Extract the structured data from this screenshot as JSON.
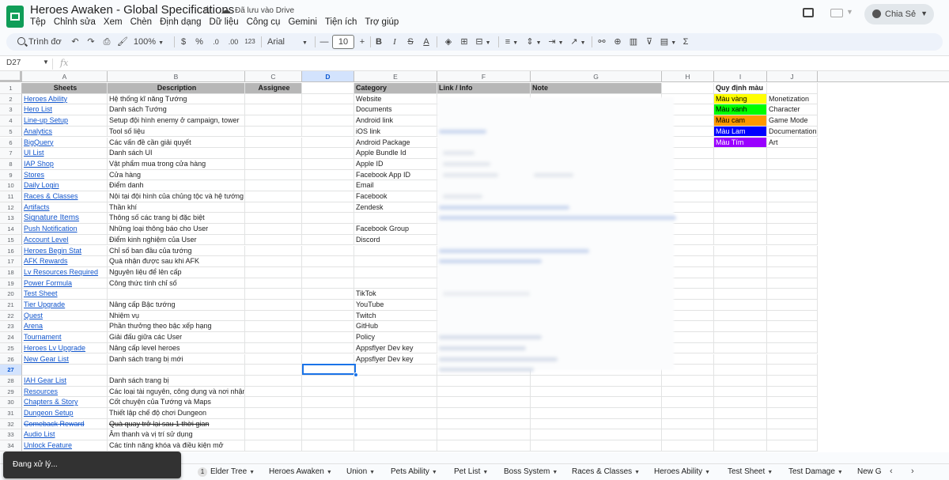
{
  "app": {
    "title": "Heroes Awaken - Global Specifications",
    "saved_status": "Đã lưu vào Drive",
    "share_label": "Chia Sẻ"
  },
  "menu": [
    "Tệp",
    "Chỉnh sửa",
    "Xem",
    "Chèn",
    "Định dạng",
    "Dữ liệu",
    "Công cụ",
    "Gemini",
    "Tiện ích",
    "Trợ giúp"
  ],
  "toolbar": {
    "search_label": "Trình đơ",
    "zoom": "100%",
    "currency": "$",
    "percent": "%",
    "dec_decrease": ".0",
    "dec_increase": ".00",
    "num_format": "123",
    "font": "Arial",
    "font_size": "10",
    "bold": "B",
    "italic": "I",
    "strike": "S",
    "text_color": "A",
    "sigma": "Σ",
    "minus": "—",
    "plus": "+"
  },
  "formula_bar": {
    "name_box": "D27",
    "fx": "fx"
  },
  "columns": [
    "A",
    "B",
    "C",
    "D",
    "E",
    "F",
    "G",
    "H",
    "I",
    "J"
  ],
  "selected_column": "D",
  "selected_row": 27,
  "header_row": {
    "sheets": "Sheets",
    "description": "Description",
    "assignee": "Assignee",
    "category": "Category",
    "link_info": "Link / Info",
    "note": "Note",
    "legend_title": "Quy định màu"
  },
  "rows": [
    {
      "n": 1
    },
    {
      "n": 2,
      "a": "Heroes Ability",
      "b": "Hệ thống kĩ năng Tướng",
      "e": "Website"
    },
    {
      "n": 3,
      "a": "Hero List",
      "b": "Danh sách Tướng",
      "e": "Documents"
    },
    {
      "n": 4,
      "a": "Line-up Setup",
      "b": "Setup đội hình enemy ở campaign, tower",
      "e": "Android link"
    },
    {
      "n": 5,
      "a": "Analytics",
      "b": "Tool số liệu",
      "e": "iOS link"
    },
    {
      "n": 6,
      "a": "BigQuery",
      "b": "Các vấn đề cần giải quyết",
      "e": "Android Package"
    },
    {
      "n": 7,
      "a": "UI List",
      "b": "Danh sách UI",
      "e": "Apple Bundle Id"
    },
    {
      "n": 8,
      "a": "IAP Shop",
      "b": "Vật phẩm mua trong cửa hàng",
      "e": "Apple ID"
    },
    {
      "n": 9,
      "a": "Stores",
      "b": "Cửa hàng",
      "e": "Facebook App ID"
    },
    {
      "n": 10,
      "a": "Daily Login",
      "b": "Điểm danh",
      "e": "Email"
    },
    {
      "n": 11,
      "a": "Races & Classes",
      "b": "Nội tại đội hình của chủng tộc và hệ tướng",
      "e": "Facebook"
    },
    {
      "n": 12,
      "a": "Artifacts",
      "b": "Thần khí",
      "e": "Zendesk"
    },
    {
      "n": 13,
      "a": "Signature Items",
      "b": "Thông số các trang bị đặc biệt",
      "e": ""
    },
    {
      "n": 14,
      "a": "Push Notification",
      "b": "Những loại thông báo cho User",
      "e": "Facebook Group"
    },
    {
      "n": 15,
      "a": "Account Level",
      "b": "Điểm kinh nghiệm của User",
      "e": "Discord"
    },
    {
      "n": 16,
      "a": "Heroes Begin Stat",
      "b": "Chỉ số ban đầu của tướng",
      "e": ""
    },
    {
      "n": 17,
      "a": "AFK Rewards",
      "b": "Quà nhận được sau khi AFK",
      "e": ""
    },
    {
      "n": 18,
      "a": "Lv Resources Required",
      "b": "Nguyên liệu để lên cấp",
      "e": ""
    },
    {
      "n": 19,
      "a": "Power Formula",
      "b": "Công thức tính chỉ số",
      "e": ""
    },
    {
      "n": 20,
      "a": "Test Sheet",
      "b": "",
      "e": "TikTok"
    },
    {
      "n": 21,
      "a": "Tier Upgrade",
      "b": "Nâng cấp Bậc tướng",
      "e": "YouTube"
    },
    {
      "n": 22,
      "a": "Quest",
      "b": "Nhiệm vụ",
      "e": "Twitch"
    },
    {
      "n": 23,
      "a": "Arena",
      "b": "Phần thưởng theo bậc xếp hạng",
      "e": "GitHub"
    },
    {
      "n": 24,
      "a": "Tournament",
      "b": "Giải đấu giữa các User",
      "e": "Policy"
    },
    {
      "n": 25,
      "a": "Heroes Lv Upgrade",
      "b": "Nâng cấp level heroes",
      "e": "Appsflyer Dev key"
    },
    {
      "n": 26,
      "a": "New Gear List",
      "b": "Danh sách trang bị mới",
      "e": "Appsflyer Dev key"
    },
    {
      "n": 27,
      "a": "",
      "b": "",
      "e": ""
    },
    {
      "n": 28,
      "a": "IAH Gear List",
      "b": "Danh sách trang bị",
      "e": ""
    },
    {
      "n": 29,
      "a": "Resources",
      "b": "Các loại tài nguyên, công dụng và nơi nhận",
      "e": ""
    },
    {
      "n": 30,
      "a": "Chapters & Story",
      "b": "Cốt chuyện của Tướng và Maps",
      "e": ""
    },
    {
      "n": 31,
      "a": "Dungeon Setup",
      "b": "Thiết lập chế độ chơi Dungeon",
      "e": ""
    },
    {
      "n": 32,
      "a": "Comeback Reward",
      "b": "Quà quay trở lại sau 1 thời gian",
      "e": "",
      "strike": true
    },
    {
      "n": 33,
      "a": "Audio List",
      "b": "Âm thanh và vị trí sử dụng",
      "e": ""
    },
    {
      "n": 34,
      "a": "Unlock Feature",
      "b": "Các tính năng khóa và điều kiện mở",
      "e": ""
    }
  ],
  "legend": [
    {
      "label": "Màu vàng",
      "meaning": "Monetization",
      "color": "#ffff00",
      "text": "#000000"
    },
    {
      "label": "Màu xanh",
      "meaning": "Character",
      "color": "#00ff00",
      "text": "#000000"
    },
    {
      "label": "Màu cam",
      "meaning": "Game Mode",
      "color": "#ff9900",
      "text": "#000000"
    },
    {
      "label": "Màu Lam",
      "meaning": "Documentation",
      "color": "#0000ff",
      "text": "#ffffff"
    },
    {
      "label": "Màu Tím",
      "meaning": "Art",
      "color": "#9900ff",
      "text": "#ffffff"
    }
  ],
  "sheet_tabs": [
    {
      "label": "Elder Tree",
      "badge": "1"
    },
    {
      "label": "Heroes Awaken"
    },
    {
      "label": "Union"
    },
    {
      "label": "Pets Ability"
    },
    {
      "label": "Pet List"
    },
    {
      "label": "Boss System"
    },
    {
      "label": "Races & Classes"
    },
    {
      "label": "Heroes Ability"
    },
    {
      "label": "Test Sheet"
    },
    {
      "label": "Test Damage"
    },
    {
      "label": "New G"
    }
  ],
  "toast": "Đang xử lý..."
}
